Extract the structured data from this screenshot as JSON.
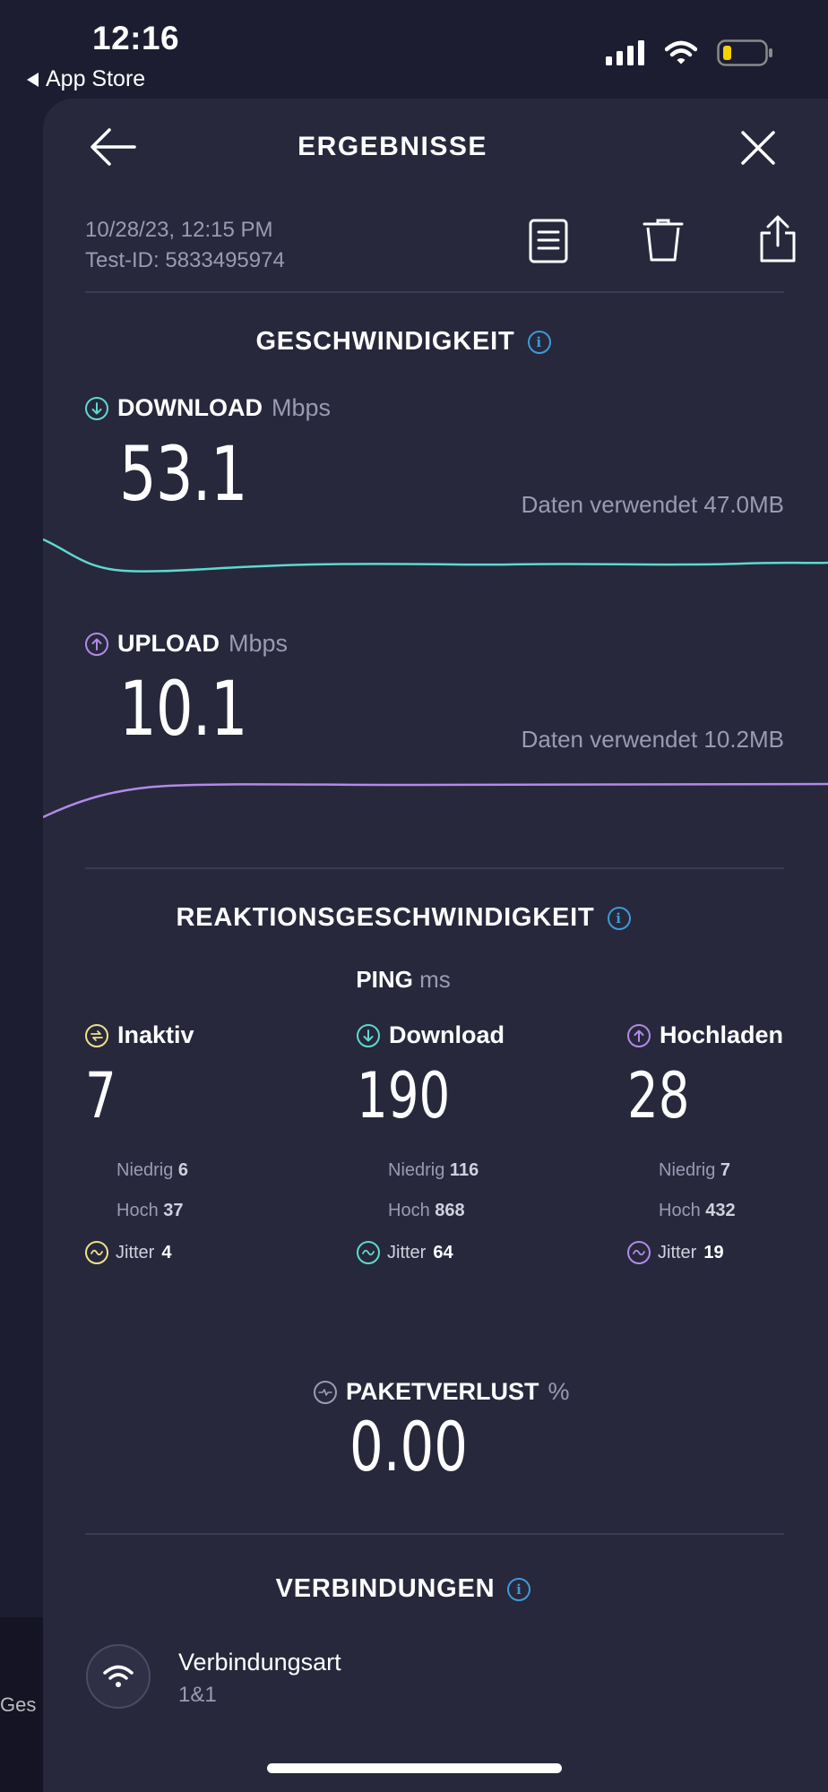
{
  "status_bar": {
    "time": "12:16",
    "back_app": "App Store"
  },
  "background": {
    "partial_text": "Ges"
  },
  "header": {
    "title": "ERGEBNISSE"
  },
  "meta": {
    "datetime": "10/28/23, 12:15 PM",
    "test_id": "Test-ID: 5833495974"
  },
  "speed": {
    "title": "GESCHWINDIGKEIT",
    "download": {
      "label": "DOWNLOAD",
      "unit": "Mbps",
      "value": "53.1",
      "data_used": "Daten verwendet 47.0MB"
    },
    "upload": {
      "label": "UPLOAD",
      "unit": "Mbps",
      "value": "10.1",
      "data_used": "Daten verwendet 10.2MB"
    }
  },
  "latency": {
    "title": "REAKTIONSGESCHWINDIGKEIT",
    "ping_label": "PING",
    "ping_unit": "ms",
    "columns": [
      {
        "label": "Inaktiv",
        "value": "7",
        "low_label": "Niedrig",
        "low": "6",
        "high_label": "Hoch",
        "high": "37",
        "jitter_label": "Jitter",
        "jitter": "4"
      },
      {
        "label": "Download",
        "value": "190",
        "low_label": "Niedrig",
        "low": "116",
        "high_label": "Hoch",
        "high": "868",
        "jitter_label": "Jitter",
        "jitter": "64"
      },
      {
        "label": "Hochladen",
        "value": "28",
        "low_label": "Niedrig",
        "low": "7",
        "high_label": "Hoch",
        "high": "432",
        "jitter_label": "Jitter",
        "jitter": "19"
      }
    ]
  },
  "packet_loss": {
    "label": "PAKETVERLUST",
    "unit": "%",
    "value": "0.00"
  },
  "connections": {
    "title": "VERBINDUNGEN",
    "type_label": "Verbindungsart",
    "type_value": "1&1"
  },
  "colors": {
    "download": "#5fd8d0",
    "upload": "#b28ae6",
    "idle": "#efe08a",
    "info": "#3f9ad6"
  }
}
